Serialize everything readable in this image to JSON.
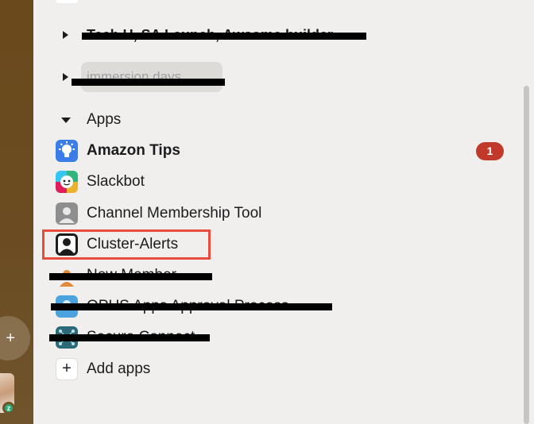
{
  "sidebar": {
    "sections": [
      {
        "label": "Tech U, SA Launch, Awsome builder",
        "redacted": true
      },
      {
        "label": "immersion days",
        "redacted": true
      },
      {
        "label": "Apps"
      }
    ],
    "apps": [
      {
        "label": "Amazon Tips",
        "bold": true,
        "badge": "1",
        "icon": "lightbulb-icon"
      },
      {
        "label": "Slackbot",
        "icon": "slackbot-icon"
      },
      {
        "label": "Channel Membership Tool",
        "icon": "default-app-icon"
      },
      {
        "label": "Cluster-Alerts",
        "icon": "default-app-icon",
        "highlighted": true
      },
      {
        "label": "New Member",
        "redacted": true,
        "icon": "person-icon"
      },
      {
        "label": "OPUS Apps Approval Process",
        "redacted": true,
        "icon": "app-icon"
      },
      {
        "label": "Secure Connect",
        "redacted": true,
        "icon": "network-icon"
      }
    ],
    "add_apps": "Add apps",
    "add_symbol": "+"
  },
  "rail": {
    "plus_symbol": "+",
    "presence_symbol": "z"
  },
  "colors": {
    "rail_bg": "#6a4a1c",
    "sidebar_bg": "#f0efed",
    "badge": "#c0392b",
    "highlight_border": "#e74c3c"
  }
}
